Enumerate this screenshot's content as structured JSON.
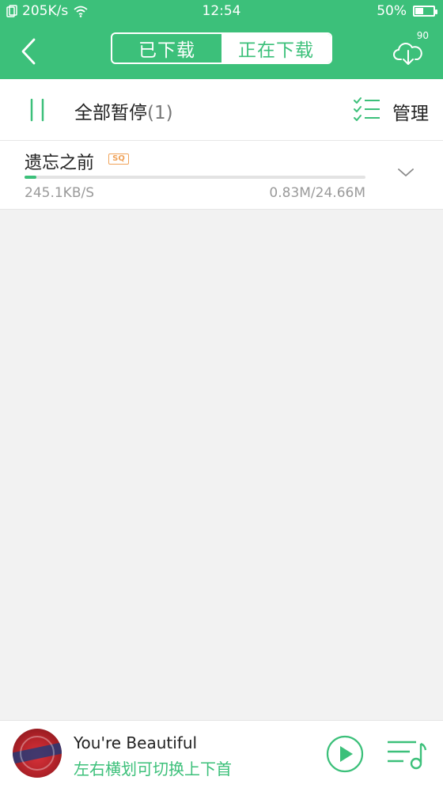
{
  "status_bar": {
    "speed": "205K/s",
    "time": "12:54",
    "battery": "50%",
    "battery_level": 0.5
  },
  "header": {
    "tabs": [
      {
        "label": "已下载",
        "active": false
      },
      {
        "label": "正在下载",
        "active": true
      }
    ],
    "download_count": "90"
  },
  "toolbar": {
    "pause_all_label": "全部暂停",
    "pause_all_count": "(1)",
    "manage_label": "管理"
  },
  "downloads": [
    {
      "title": "遗忘之前",
      "quality_badge": "SQ",
      "speed": "245.1KB/S",
      "size": "0.83M/24.66M",
      "progress": 0.034
    }
  ],
  "player": {
    "song_title": "You're Beautiful",
    "hint": "左右横划可切换上下首"
  },
  "colors": {
    "accent": "#3cc07a",
    "badge": "#f0a35a"
  },
  "icons": [
    "back-icon",
    "cloud-download-icon",
    "pause-icon",
    "checklist-icon",
    "chevron-down-icon",
    "play-icon",
    "playlist-icon",
    "wifi-icon",
    "sim-icon",
    "battery-icon"
  ]
}
